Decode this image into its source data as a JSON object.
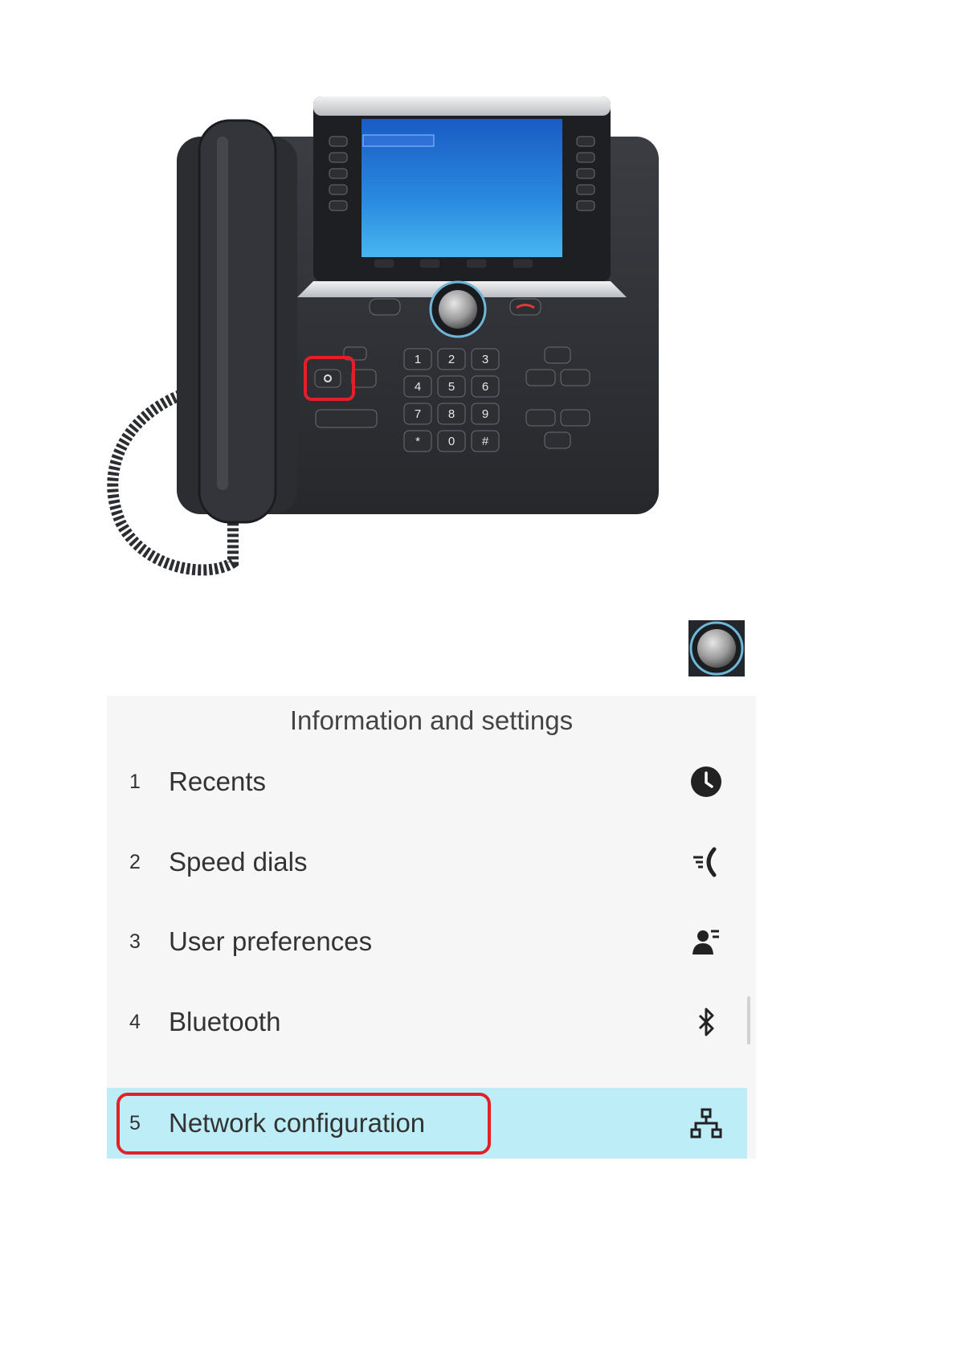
{
  "panel": {
    "title": "Information and settings"
  },
  "menu": {
    "items": [
      {
        "num": "1",
        "label": "Recents",
        "icon": "clock-icon"
      },
      {
        "num": "2",
        "label": "Speed dials",
        "icon": "speed-dial-icon"
      },
      {
        "num": "3",
        "label": "User preferences",
        "icon": "user-preferences-icon"
      },
      {
        "num": "4",
        "label": "Bluetooth",
        "icon": "bluetooth-icon"
      },
      {
        "num": "5",
        "label": "Network configuration",
        "icon": "network-icon",
        "selected": true
      }
    ]
  },
  "phone": {
    "keypad": [
      "1",
      "2",
      "3",
      "4",
      "5",
      "6",
      "7",
      "8",
      "9",
      "*",
      "0",
      "#"
    ]
  },
  "colors": {
    "highlight_outline": "#e3202a",
    "selected_row": "#bdeef7",
    "panel_bg": "#f6f6f6"
  }
}
